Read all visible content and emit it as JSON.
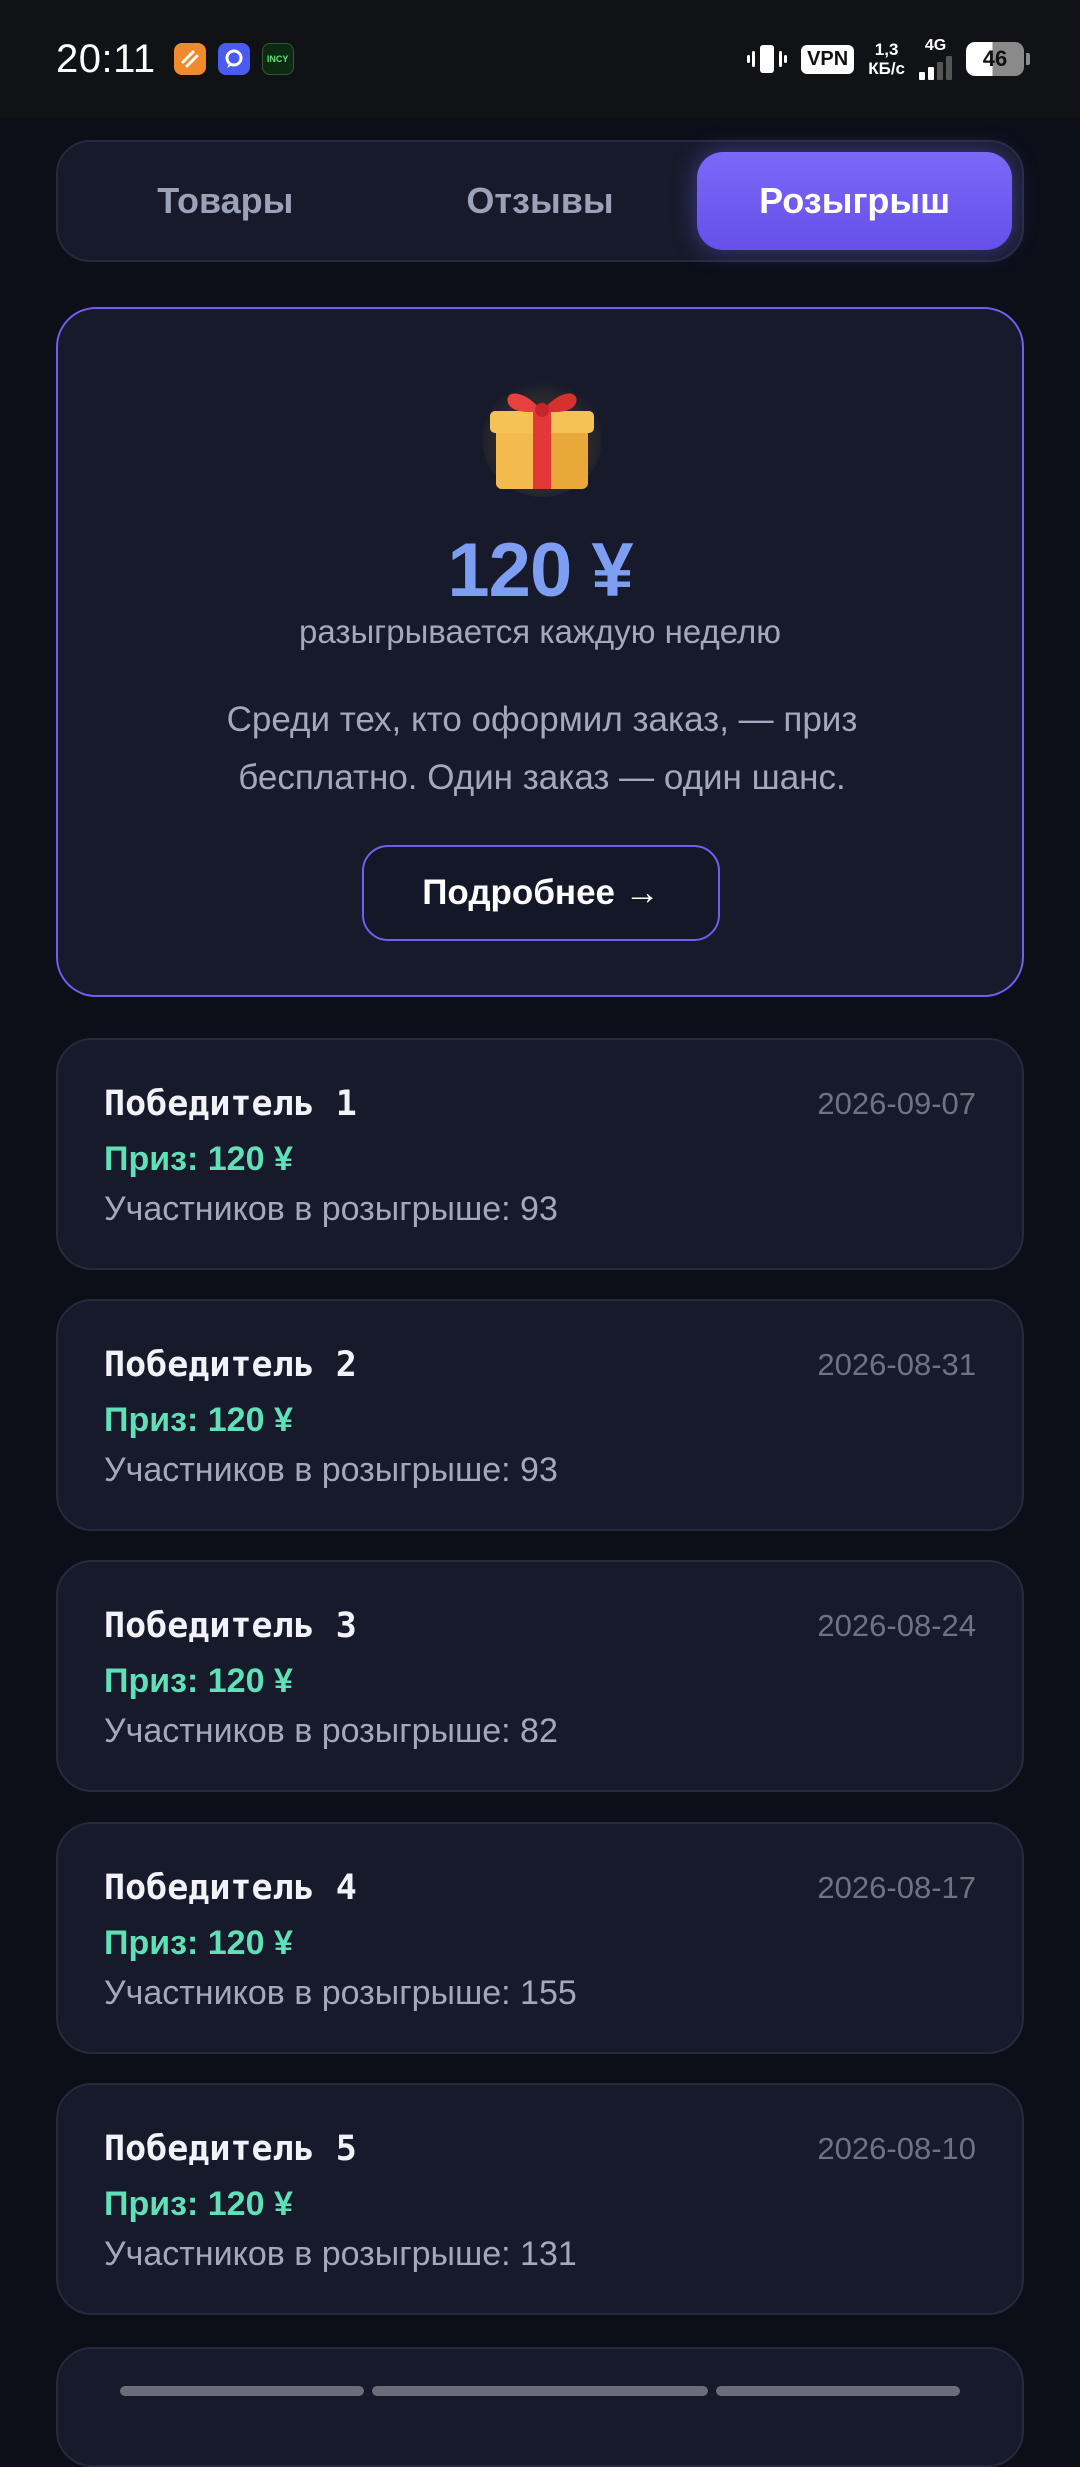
{
  "status_bar": {
    "time": "20:11",
    "apps": [
      "app-1",
      "app-2",
      "INCY"
    ],
    "vpn": "VPN",
    "speed_value": "1,3",
    "speed_unit": "КБ/с",
    "network": "4G",
    "battery": "46"
  },
  "tabs": [
    {
      "label": "Товары",
      "active": false
    },
    {
      "label": "Отзывы",
      "active": false
    },
    {
      "label": "Розыгрыш",
      "active": true
    }
  ],
  "prize": {
    "icon": "gift-icon",
    "amount": "120 ¥",
    "subtitle": "разыгрывается каждую неделю",
    "description": "Среди тех, кто оформил заказ, — приз бесплатно. Один заказ — один шанс.",
    "more_button": "Подробнее →"
  },
  "winners": [
    {
      "name": "Победитель 1",
      "date": "2026-09-07",
      "prize": "Приз: 120 ¥",
      "participants": "Участников в розыгрыше: 93"
    },
    {
      "name": "Победитель 2",
      "date": "2026-08-31",
      "prize": "Приз: 120 ¥",
      "participants": "Участников в розыгрыше: 93"
    },
    {
      "name": "Победитель 3",
      "date": "2026-08-24",
      "prize": "Приз: 120 ¥",
      "participants": "Участников в розыгрыше: 82"
    },
    {
      "name": "Победитель 4",
      "date": "2026-08-17",
      "prize": "Приз: 120 ¥",
      "participants": "Участников в розыгрыше: 155"
    },
    {
      "name": "Победитель 5",
      "date": "2026-08-10",
      "prize": "Приз: 120 ¥",
      "participants": "Участников в розыгрыше: 131"
    }
  ],
  "colors": {
    "accent": "#6f5ff0",
    "amount": "#7d9ef3",
    "prize_text": "#5fe0b7",
    "background": "#0c0e18",
    "card": "#161a2a"
  }
}
